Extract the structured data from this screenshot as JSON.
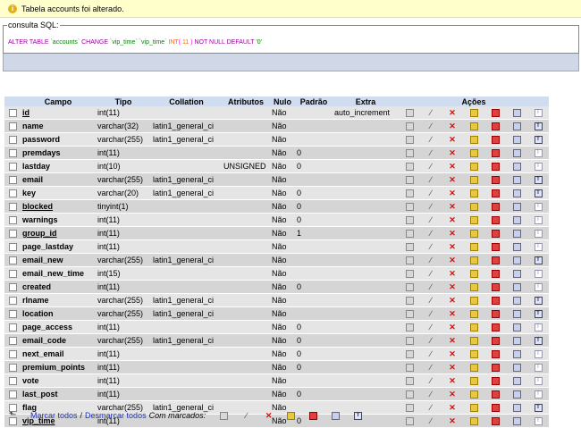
{
  "notice": {
    "text": "Tabela accounts foi alterado.",
    "icon": "info-icon"
  },
  "sql": {
    "legend": "consulta SQL:",
    "tokens": [
      {
        "t": "ALTER TABLE ",
        "c": "kw"
      },
      {
        "t": "`accounts` ",
        "c": "str"
      },
      {
        "t": "CHANGE ",
        "c": "kw"
      },
      {
        "t": "`vip_time` ",
        "c": "str"
      },
      {
        "t": "`vip_time` ",
        "c": "str"
      },
      {
        "t": "INT",
        "c": "num"
      },
      {
        "t": "( ",
        "c": "paren"
      },
      {
        "t": "11 ",
        "c": "num"
      },
      {
        "t": ") ",
        "c": "paren"
      },
      {
        "t": "NOT NULL DEFAULT ",
        "c": "kw"
      },
      {
        "t": "'0'",
        "c": "str"
      }
    ]
  },
  "table": {
    "headers": [
      "Campo",
      "Tipo",
      "Collation",
      "Atributos",
      "Nulo",
      "Padrão",
      "Extra",
      "Ações"
    ],
    "rows": [
      {
        "campo": "id",
        "primary": true,
        "tipo": "int(11)",
        "collation": "",
        "atributos": "",
        "nulo": "Não",
        "padrao": "",
        "extra": "auto_increment",
        "fulltext": false
      },
      {
        "campo": "name",
        "tipo": "varchar(32)",
        "collation": "latin1_general_ci",
        "atributos": "",
        "nulo": "Não",
        "padrao": "",
        "extra": "",
        "fulltext": true
      },
      {
        "campo": "password",
        "tipo": "varchar(255)",
        "collation": "latin1_general_ci",
        "atributos": "",
        "nulo": "Não",
        "padrao": "",
        "extra": "",
        "fulltext": true
      },
      {
        "campo": "premdays",
        "tipo": "int(11)",
        "collation": "",
        "atributos": "",
        "nulo": "Não",
        "padrao": "0",
        "extra": "",
        "fulltext": false
      },
      {
        "campo": "lastday",
        "tipo": "int(10)",
        "collation": "",
        "atributos": "UNSIGNED",
        "nulo": "Não",
        "padrao": "0",
        "extra": "",
        "fulltext": false
      },
      {
        "campo": "email",
        "tipo": "varchar(255)",
        "collation": "latin1_general_ci",
        "atributos": "",
        "nulo": "Não",
        "padrao": "",
        "extra": "",
        "fulltext": true
      },
      {
        "campo": "key",
        "tipo": "varchar(20)",
        "collation": "latin1_general_ci",
        "atributos": "",
        "nulo": "Não",
        "padrao": "0",
        "extra": "",
        "fulltext": true
      },
      {
        "campo": "blocked",
        "primary": true,
        "tipo": "tinyint(1)",
        "collation": "",
        "atributos": "",
        "nulo": "Não",
        "padrao": "0",
        "extra": "",
        "fulltext": false
      },
      {
        "campo": "warnings",
        "tipo": "int(11)",
        "collation": "",
        "atributos": "",
        "nulo": "Não",
        "padrao": "0",
        "extra": "",
        "fulltext": false
      },
      {
        "campo": "group_id",
        "primary": true,
        "tipo": "int(11)",
        "collation": "",
        "atributos": "",
        "nulo": "Não",
        "padrao": "1",
        "extra": "",
        "fulltext": false
      },
      {
        "campo": "page_lastday",
        "tipo": "int(11)",
        "collation": "",
        "atributos": "",
        "nulo": "Não",
        "padrao": "",
        "extra": "",
        "fulltext": false
      },
      {
        "campo": "email_new",
        "tipo": "varchar(255)",
        "collation": "latin1_general_ci",
        "atributos": "",
        "nulo": "Não",
        "padrao": "",
        "extra": "",
        "fulltext": true
      },
      {
        "campo": "email_new_time",
        "tipo": "int(15)",
        "collation": "",
        "atributos": "",
        "nulo": "Não",
        "padrao": "",
        "extra": "",
        "fulltext": false
      },
      {
        "campo": "created",
        "tipo": "int(11)",
        "collation": "",
        "atributos": "",
        "nulo": "Não",
        "padrao": "0",
        "extra": "",
        "fulltext": false
      },
      {
        "campo": "rlname",
        "tipo": "varchar(255)",
        "collation": "latin1_general_ci",
        "atributos": "",
        "nulo": "Não",
        "padrao": "",
        "extra": "",
        "fulltext": true
      },
      {
        "campo": "location",
        "tipo": "varchar(255)",
        "collation": "latin1_general_ci",
        "atributos": "",
        "nulo": "Não",
        "padrao": "",
        "extra": "",
        "fulltext": true
      },
      {
        "campo": "page_access",
        "tipo": "int(11)",
        "collation": "",
        "atributos": "",
        "nulo": "Não",
        "padrao": "0",
        "extra": "",
        "fulltext": false
      },
      {
        "campo": "email_code",
        "tipo": "varchar(255)",
        "collation": "latin1_general_ci",
        "atributos": "",
        "nulo": "Não",
        "padrao": "0",
        "extra": "",
        "fulltext": true
      },
      {
        "campo": "next_email",
        "tipo": "int(11)",
        "collation": "",
        "atributos": "",
        "nulo": "Não",
        "padrao": "0",
        "extra": "",
        "fulltext": false
      },
      {
        "campo": "premium_points",
        "tipo": "int(11)",
        "collation": "",
        "atributos": "",
        "nulo": "Não",
        "padrao": "0",
        "extra": "",
        "fulltext": false
      },
      {
        "campo": "vote",
        "tipo": "int(11)",
        "collation": "",
        "atributos": "",
        "nulo": "Não",
        "padrao": "",
        "extra": "",
        "fulltext": false
      },
      {
        "campo": "last_post",
        "tipo": "int(11)",
        "collation": "",
        "atributos": "",
        "nulo": "Não",
        "padrao": "0",
        "extra": "",
        "fulltext": false
      },
      {
        "campo": "flag",
        "tipo": "varchar(255)",
        "collation": "latin1_general_ci",
        "atributos": "",
        "nulo": "Não",
        "padrao": "",
        "extra": "",
        "fulltext": true
      },
      {
        "campo": "vip_time",
        "primary": true,
        "tipo": "int(11)",
        "collation": "",
        "atributos": "",
        "nulo": "Não",
        "padrao": "0",
        "extra": "",
        "fulltext": false
      }
    ],
    "action_icons": [
      "browse-icon",
      "edit-icon",
      "drop-icon",
      "primary-key-icon",
      "unique-icon",
      "index-icon",
      "fulltext-icon"
    ]
  },
  "footer": {
    "check_all": "Marcar todos",
    "separator": "/",
    "uncheck_all": "Desmarcar todos",
    "with_selected": "Com marcados:"
  },
  "colors": {
    "header_bg": "#d0dcf0",
    "row_odd": "#e5e5e5",
    "row_even": "#d5d5d5",
    "notice_bg": "#ffffcc",
    "link": "#1a30c0"
  }
}
